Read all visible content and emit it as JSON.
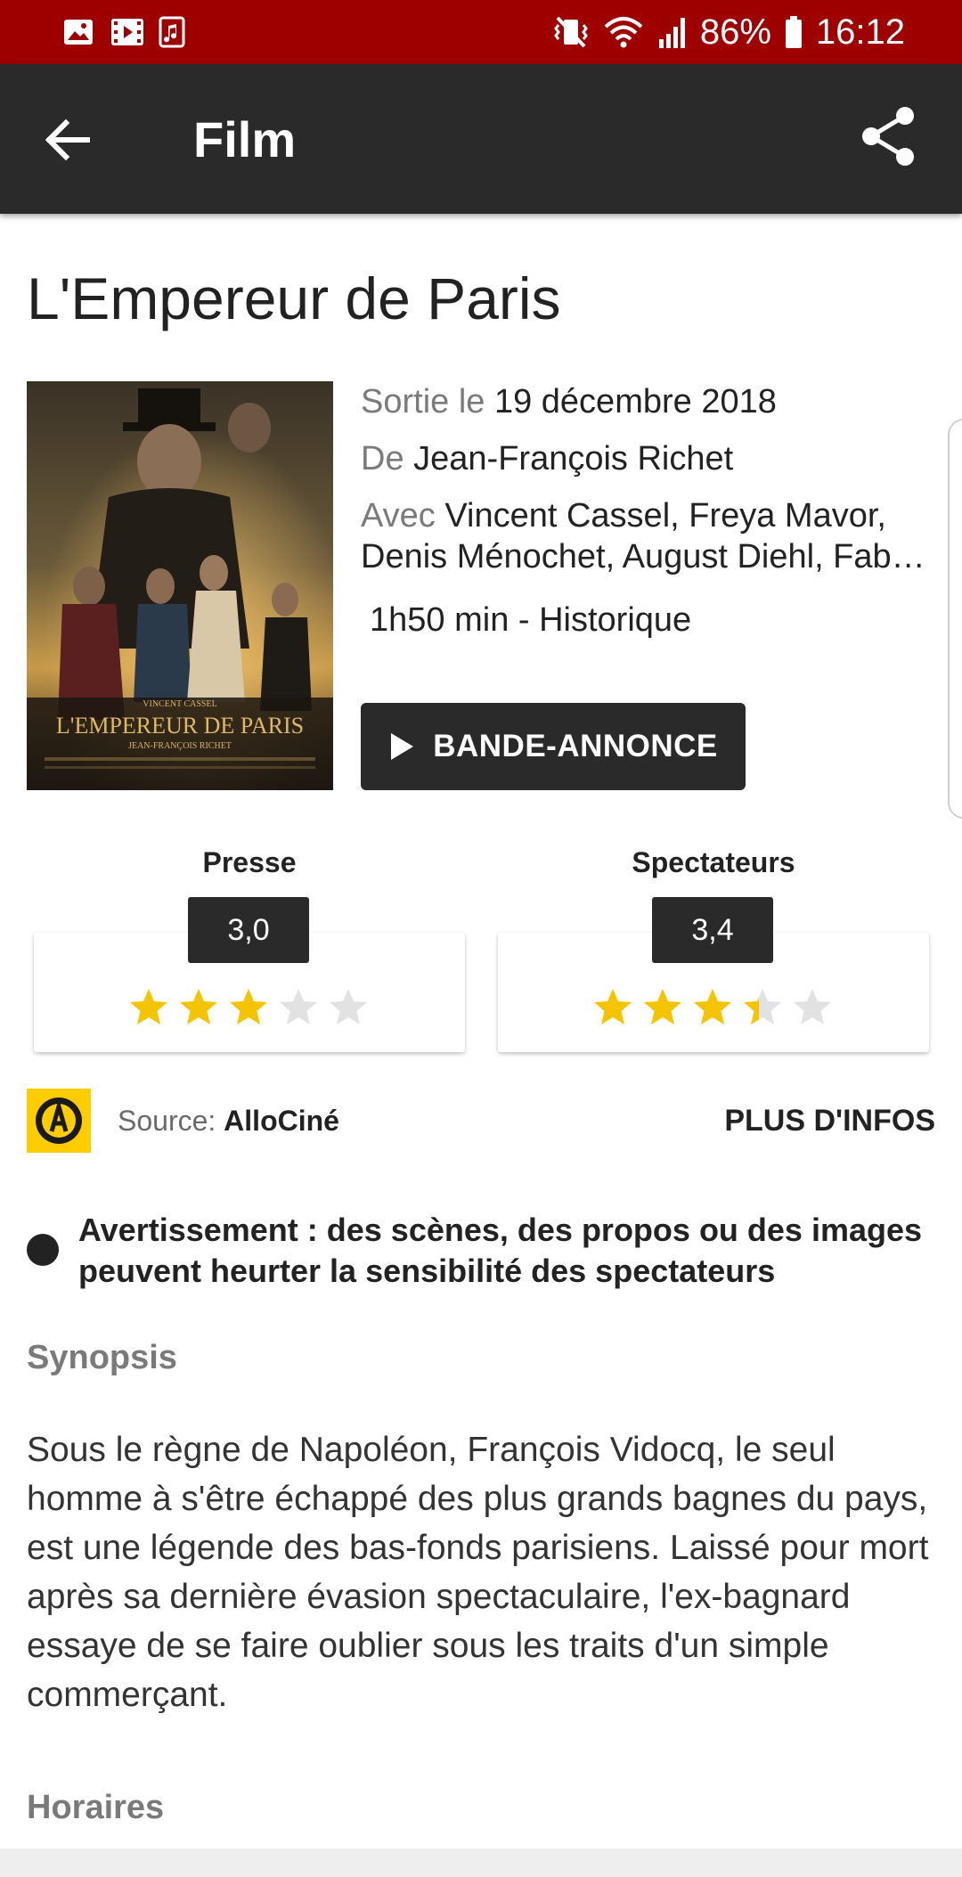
{
  "status_bar": {
    "battery": "86%",
    "time": "16:12",
    "background": "#9e0000"
  },
  "toolbar": {
    "title": "Film",
    "back_icon": "arrow-left-icon",
    "share_icon": "share-icon",
    "background": "#2a2a2a"
  },
  "movie": {
    "title": "L'Empereur de Paris",
    "poster": {
      "top_credit": "VINCENT CASSEL",
      "title_line": "L'EMPEREUR DE PARIS",
      "director_credit": "JEAN-FRANÇOIS RICHET"
    },
    "release_label": "Sortie le",
    "release_date": "19 décembre 2018",
    "director_label": "De",
    "director": "Jean-François Richet",
    "cast_label": "Avec",
    "cast_line1": "Vincent Cassel, Freya Mavor,",
    "cast_line2": "Denis Ménochet, August Diehl, Fab…",
    "duration_genre": "1h50 min - Historique",
    "trailer_button": "BANDE-ANNONCE"
  },
  "ratings": {
    "press": {
      "label": "Presse",
      "value": "3,0",
      "stars": 3.0
    },
    "spectators": {
      "label": "Spectateurs",
      "value": "3,4",
      "stars": 3.4
    },
    "star_color": "#f5c400",
    "star_empty_color": "#e2e2e2"
  },
  "source": {
    "label": "Source:",
    "name": "AlloCiné",
    "more_info": "PLUS D'INFOS"
  },
  "warning": {
    "text": "Avertissement : des scènes, des propos ou des images peuvent heurter la sensibilité des spectateurs"
  },
  "synopsis": {
    "title": "Synopsis",
    "text": "Sous le règne de Napoléon, François Vidocq, le seul homme à s'être échappé des plus grands bagnes du pays, est une légende des bas-fonds parisiens. Laissé pour mort après sa dernière évasion spectaculaire, l'ex-bagnard essaye de se faire oublier sous les traits d'un simple commerçant."
  },
  "horaires": {
    "title": "Horaires"
  }
}
